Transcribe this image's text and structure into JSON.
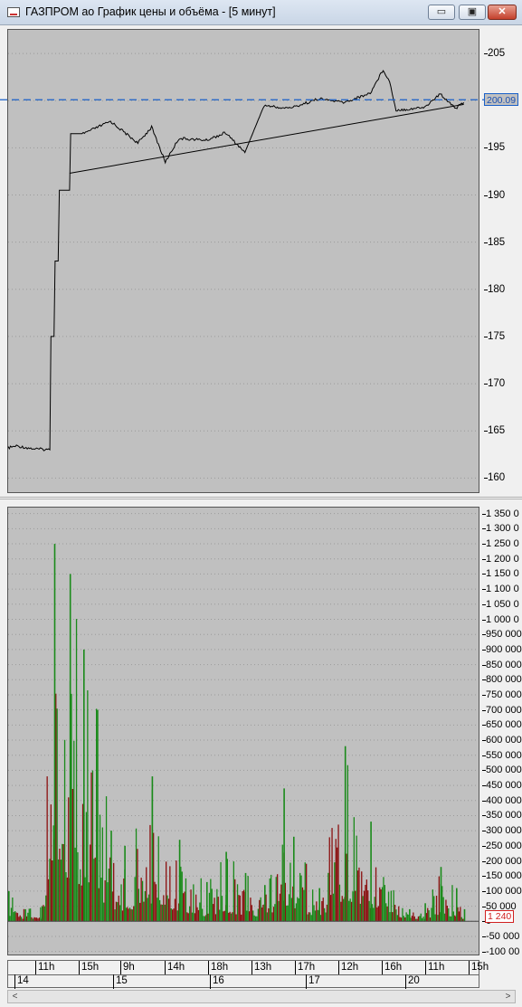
{
  "window": {
    "title": "ГАЗПРОМ ао График цены и объёма - [5 минут]",
    "min_glyph": "▭",
    "max_glyph": "▣",
    "close_glyph": "✕"
  },
  "price_axis": {
    "ticks": [
      "205",
      "200",
      "195",
      "190",
      "185",
      "180",
      "175",
      "170",
      "165",
      "160"
    ],
    "current_price": "200.09"
  },
  "volume_axis": {
    "ticks": [
      "1 350 0",
      "1 300 0",
      "1 250 0",
      "1 200 0",
      "1 150 0",
      "1 100 0",
      "1 050 0",
      "1 000 0",
      "950 000",
      "900 000",
      "850 000",
      "800 000",
      "750 000",
      "700 000",
      "650 000",
      "600 000",
      "550 000",
      "500 000",
      "450 000",
      "400 000",
      "350 000",
      "300 000",
      "250 000",
      "200 000",
      "150 000",
      "100 000",
      "50 000",
      "0",
      "-50 000",
      "-100 00"
    ],
    "current_volume": "1 240"
  },
  "time_axis": {
    "hours": [
      "11h",
      "15h",
      "9h",
      "14h",
      "18h",
      "13h",
      "17h",
      "12h",
      "16h",
      "11h",
      "15h"
    ],
    "days": [
      "14",
      "15",
      "16",
      "17",
      "20"
    ]
  },
  "scrollbar": {
    "left": "<",
    "right": ">"
  },
  "colors": {
    "price_line": "#000000",
    "level_line": "#1a60c8",
    "vol_up": "#1a8a1a",
    "vol_down": "#8b1010",
    "panel_bg": "#c0c0c0",
    "grid": "#9a9a9a"
  },
  "chart_data": [
    {
      "type": "line",
      "title": "",
      "xlabel": "",
      "ylabel": "",
      "ylim": [
        158.5,
        207.5
      ],
      "x": [
        "14 10:00",
        "14 11:00",
        "14 13:00",
        "14 15:00",
        "14 15:30",
        "14 16:00",
        "15 9:00",
        "15 10:00",
        "15 12:00",
        "15 14:00",
        "15 15:00",
        "15 16:00",
        "15 17:00",
        "16 10:00",
        "16 12:00",
        "16 14:00",
        "16 16:00",
        "16 18:00",
        "17 10:00",
        "17 12:00",
        "17 14:00",
        "17 16:00",
        "17 17:00",
        "17 17:30",
        "17 18:00",
        "20 10:00",
        "20 12:00",
        "20 14:00",
        "20 16:00",
        "20 17:00"
      ],
      "series": [
        {
          "values": [
            163.2,
            163.4,
            163.1,
            163.0,
            175.0,
            183.0,
            190.5,
            196.5,
            197.8,
            195.5,
            197.2,
            193.5,
            196.0,
            195.8,
            196.6,
            194.5,
            199.5,
            199.2,
            199.3,
            200.2,
            199.8,
            200.8,
            203.3,
            202.0,
            199.0,
            199.1,
            199.3,
            200.7,
            199.2,
            199.8
          ]
        }
      ],
      "trendline": {
        "from": [
          "15 9:00",
          192.3
        ],
        "to": [
          "20 17:00",
          199.6
        ]
      },
      "level_line": 200.09,
      "grid": true
    },
    {
      "type": "bar",
      "title": "",
      "xlabel": "",
      "ylabel": "",
      "ylim": [
        -110000,
        1370000
      ],
      "categories": [
        "14 10:00",
        "14 12:00",
        "14 14:00",
        "14 15:30",
        "15 9:00",
        "15 10:00",
        "15 11:00",
        "15 12:00",
        "15 13:00",
        "15 15:00",
        "15 17:00",
        "16 10:00",
        "16 12:00",
        "16 14:00",
        "16 16:00",
        "16 18:00",
        "17 10:00",
        "17 12:00",
        "17 14:00",
        "17 16:00",
        "20 10:00",
        "20 12:00",
        "20 14:00",
        "20 16:00",
        "20 17:00"
      ],
      "series": [
        {
          "name": "",
          "values": [
            100000,
            40000,
            50000,
            1250000,
            1150000,
            900000,
            700000,
            300000,
            250000,
            480000,
            270000,
            130000,
            230000,
            160000,
            120000,
            440000,
            280000,
            110000,
            580000,
            330000,
            40000,
            60000,
            180000,
            110000,
            40000
          ]
        }
      ],
      "grid": true
    }
  ]
}
